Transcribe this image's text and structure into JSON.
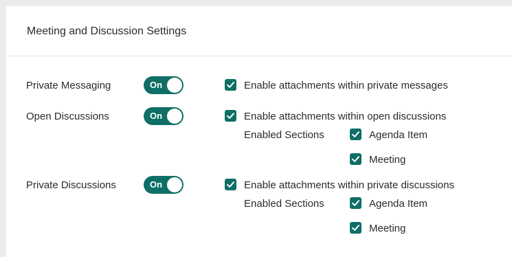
{
  "panel": {
    "title": "Meeting and Discussion Settings"
  },
  "accent_color": "#0f6f66",
  "settings": [
    {
      "label": "Private Messaging",
      "toggle": "On",
      "attachments": {
        "label": "Enable attachments within private messages",
        "checked": true
      }
    },
    {
      "label": "Open Discussions",
      "toggle": "On",
      "attachments": {
        "label": "Enable attachments within open discussions",
        "checked": true
      },
      "sections_label": "Enabled Sections",
      "sections": [
        {
          "label": "Agenda Item",
          "checked": true
        },
        {
          "label": "Meeting",
          "checked": true
        }
      ]
    },
    {
      "label": "Private Discussions",
      "toggle": "On",
      "attachments": {
        "label": "Enable attachments within private discussions",
        "checked": true
      },
      "sections_label": "Enabled Sections",
      "sections": [
        {
          "label": "Agenda Item",
          "checked": true
        },
        {
          "label": "Meeting",
          "checked": true
        }
      ]
    }
  ]
}
